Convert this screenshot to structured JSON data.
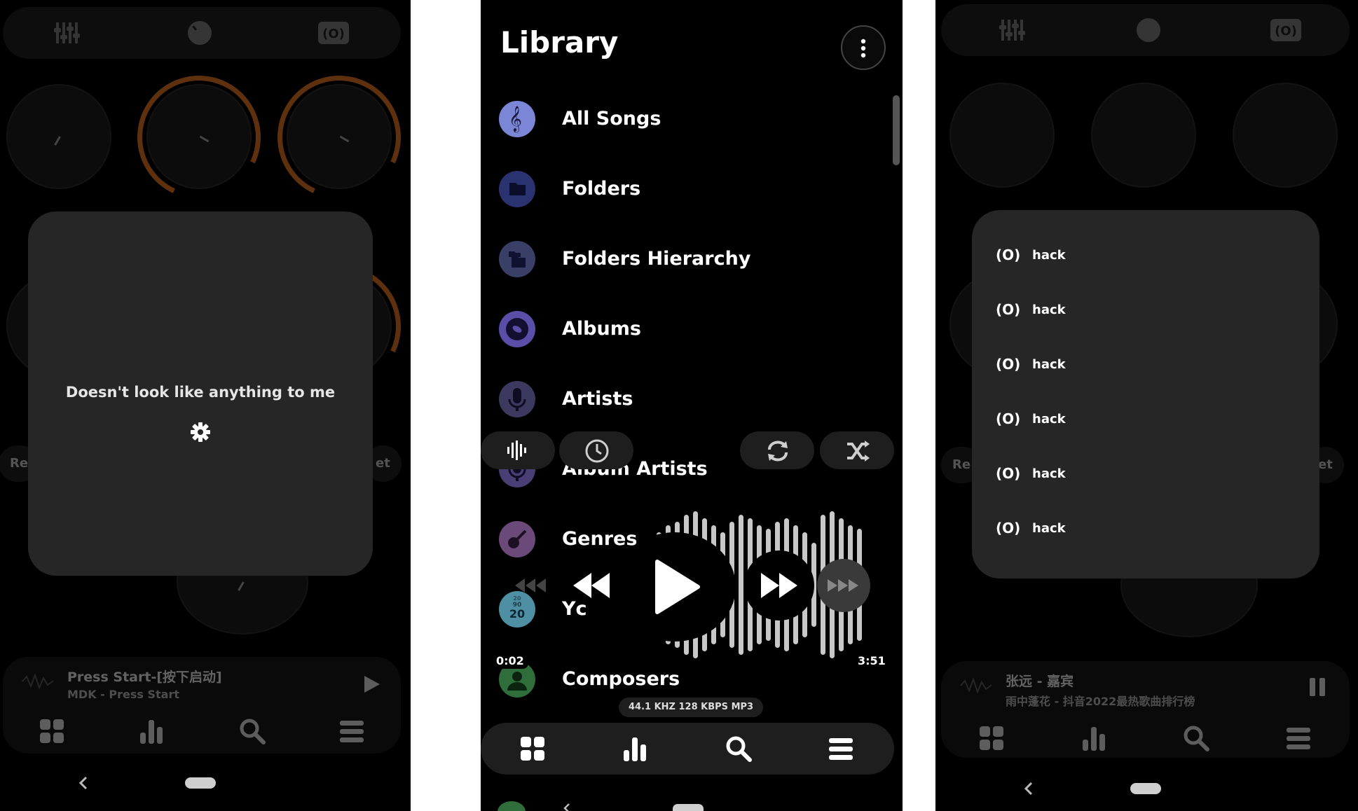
{
  "panel1": {
    "overlay_message": "Doesn't look like anything to me",
    "left_pill": "Re",
    "right_pill": "et",
    "now_playing": {
      "title": "Press Start-[按下启动]",
      "subtitle": "MDK - Press Start",
      "state": "paused"
    },
    "icons": [
      "equalizer-icon",
      "knob-icon",
      "surround-icon",
      "settings-icon",
      "grid-icon",
      "bars-icon",
      "search-icon",
      "menu-icon",
      "play-icon",
      "back-icon",
      "home-pill"
    ]
  },
  "panel2": {
    "title": "Library",
    "items": [
      {
        "label": "All Songs",
        "icon": "treble-clef-icon",
        "color": "#7b86d6"
      },
      {
        "label": "Folders",
        "icon": "folder-icon",
        "color": "#2b3270"
      },
      {
        "label": "Folders Hierarchy",
        "icon": "folder-tree-icon",
        "color": "#3a3f67"
      },
      {
        "label": "Albums",
        "icon": "album-icon",
        "color": "#5a4fa8"
      },
      {
        "label": "Artists",
        "icon": "microphone-icon",
        "color": "#3b3a5e"
      },
      {
        "label": "Album Artists",
        "icon": "microphone-icon",
        "color": "#4a3f75"
      },
      {
        "label": "Genres",
        "icon": "guitar-icon",
        "color": "#6b4a7a"
      },
      {
        "label": "Yc",
        "icon": "calendar-icon",
        "color": "#4e8fa3",
        "year_lines": [
          "20",
          "90",
          "20"
        ]
      },
      {
        "label": "Composers",
        "icon": "composer-icon",
        "color": "#2f6d3a"
      }
    ],
    "player": {
      "elapsed": "0:02",
      "duration": "3:51",
      "format": "44.1 KHZ  128 KBPS  MP3"
    },
    "icons": [
      "more-vert-icon",
      "waveform-icon",
      "clock-icon",
      "repeat-icon",
      "shuffle-icon",
      "rewind-icon",
      "play-icon",
      "fast-forward-icon",
      "grid-icon",
      "bars-icon",
      "search-icon",
      "menu-icon"
    ]
  },
  "panel3": {
    "hack_items": [
      "hack",
      "hack",
      "hack",
      "hack",
      "hack",
      "hack"
    ],
    "hack_icon_text": "(O)",
    "left_pill": "Re",
    "right_pill": "et",
    "now_playing": {
      "title": "张远 - 嘉宾",
      "subtitle": "雨中蓬花 - 抖音2022最热歌曲排行榜",
      "state": "playing"
    }
  },
  "colors": {
    "accent_orange": "#d06a1f",
    "surface": "#1e1e1e",
    "modal": "#262626",
    "background": "#000000"
  }
}
